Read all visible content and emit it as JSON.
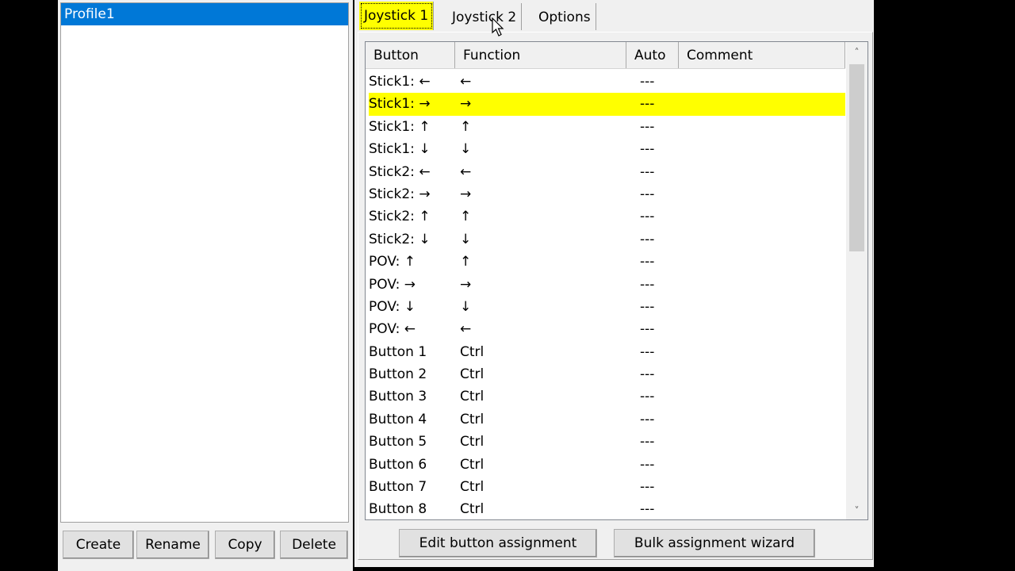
{
  "profiles": {
    "items": [
      "Profile1"
    ],
    "selected": "Profile1"
  },
  "profile_buttons": {
    "create": "Create",
    "rename": "Rename",
    "copy": "Copy",
    "delete": "Delete"
  },
  "tabs": [
    {
      "label": "Joystick 1",
      "active": true
    },
    {
      "label": "Joystick 2",
      "active": false
    },
    {
      "label": "Options",
      "active": false
    }
  ],
  "table": {
    "columns": [
      "Button",
      "Function",
      "Auto",
      "Comment"
    ],
    "selected_row": 1,
    "highlight_color": "#ffff00",
    "rows": [
      {
        "button": "Stick1: ←",
        "function": "←",
        "auto": "---",
        "comment": ""
      },
      {
        "button": "Stick1: →",
        "function": "→",
        "auto": "---",
        "comment": ""
      },
      {
        "button": "Stick1: ↑",
        "function": "↑",
        "auto": "---",
        "comment": ""
      },
      {
        "button": "Stick1: ↓",
        "function": "↓",
        "auto": "---",
        "comment": ""
      },
      {
        "button": "Stick2: ←",
        "function": "←",
        "auto": "---",
        "comment": ""
      },
      {
        "button": "Stick2: →",
        "function": "→",
        "auto": "---",
        "comment": ""
      },
      {
        "button": "Stick2: ↑",
        "function": "↑",
        "auto": "---",
        "comment": ""
      },
      {
        "button": "Stick2: ↓",
        "function": "↓",
        "auto": "---",
        "comment": ""
      },
      {
        "button": "POV: ↑",
        "function": "↑",
        "auto": "---",
        "comment": ""
      },
      {
        "button": "POV: →",
        "function": "→",
        "auto": "---",
        "comment": ""
      },
      {
        "button": "POV: ↓",
        "function": "↓",
        "auto": "---",
        "comment": ""
      },
      {
        "button": "POV: ←",
        "function": "←",
        "auto": "---",
        "comment": ""
      },
      {
        "button": "Button 1",
        "function": "Ctrl",
        "auto": "---",
        "comment": ""
      },
      {
        "button": "Button 2",
        "function": "Ctrl",
        "auto": "---",
        "comment": ""
      },
      {
        "button": "Button 3",
        "function": "Ctrl",
        "auto": "---",
        "comment": ""
      },
      {
        "button": "Button 4",
        "function": "Ctrl",
        "auto": "---",
        "comment": ""
      },
      {
        "button": "Button 5",
        "function": "Ctrl",
        "auto": "---",
        "comment": ""
      },
      {
        "button": "Button 6",
        "function": "Ctrl",
        "auto": "---",
        "comment": ""
      },
      {
        "button": "Button 7",
        "function": "Ctrl",
        "auto": "---",
        "comment": ""
      },
      {
        "button": "Button 8",
        "function": "Ctrl",
        "auto": "---",
        "comment": ""
      }
    ]
  },
  "actions": {
    "edit": "Edit button assignment",
    "bulk": "Bulk assignment wizard"
  }
}
